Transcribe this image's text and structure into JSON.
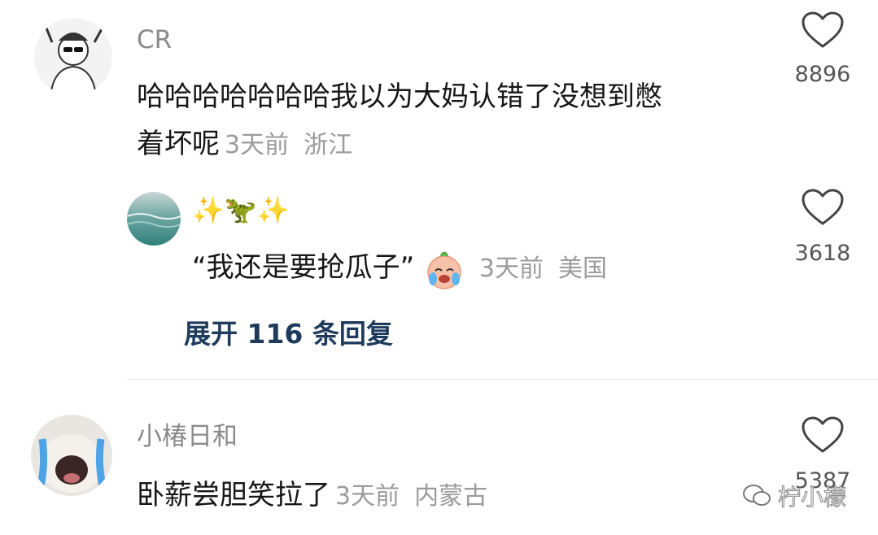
{
  "comments": [
    {
      "username": "CR",
      "text_line1": "哈哈哈哈哈哈哈我以为大妈认错了没想到憋",
      "text_line2": "着坏呢",
      "time": "3天前",
      "location": "浙江",
      "likes": "8896",
      "avatar_icon": "sketch-boy-sunglasses-avatar"
    },
    {
      "username": "✨🦖✨",
      "text": "“我还是要抢瓜子”",
      "emoji": "crying-face-emoji",
      "time": "3天前",
      "location": "美国",
      "likes": "3618",
      "avatar_icon": "ocean-water-avatar"
    },
    {
      "username": "小椿日和",
      "text": "卧薪尝胆笑拉了",
      "time": "3天前",
      "location": "内蒙古",
      "likes": "5387",
      "avatar_icon": "crying-cat-avatar"
    }
  ],
  "expand_replies": "展开 116 条回复",
  "watermark": "柠小檬",
  "colors": {
    "name": "#8a8a8a",
    "text": "#161616",
    "meta": "#9b9b9b",
    "expand": "#1f3b5c"
  }
}
